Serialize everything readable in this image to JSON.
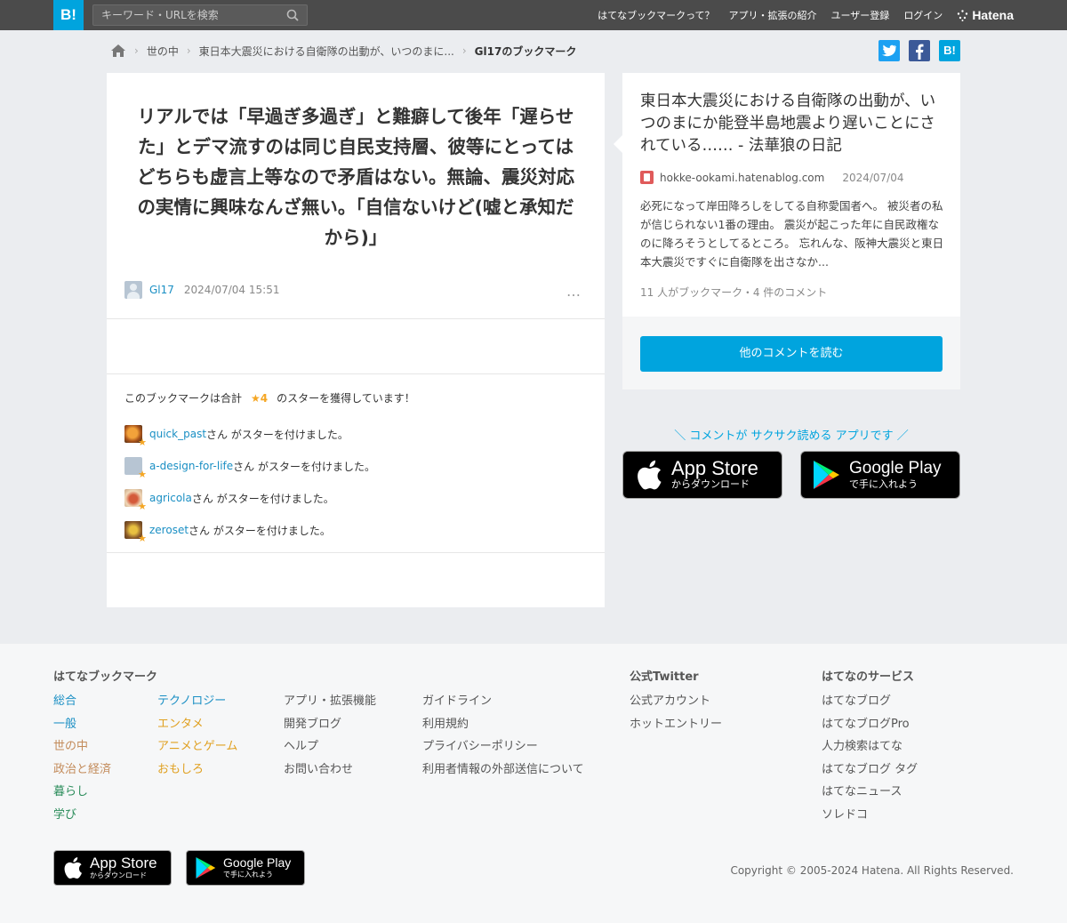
{
  "header": {
    "logo": "B!",
    "search_placeholder": "キーワード・URLを検索",
    "nav": [
      "はてなブックマークって？",
      "アプリ・拡張の紹介",
      "ユーザー登録",
      "ログイン"
    ],
    "brand": "Hatena"
  },
  "breadcrumb": {
    "items": [
      "世の中",
      "東日本大震災における自衛隊の出動が、いつのまに...",
      "Gl17のブックマーク"
    ]
  },
  "share": {
    "hatena": "B!"
  },
  "bookmark": {
    "comment": "リアルでは「早過ぎ多過ぎ」と難癖して後年「遅らせた」とデマ流すのは同じ自民支持層、彼等にとってはどちらも虚言上等なので矛盾はない。無論、震災対応の実情に興味なんざ無い。「自信ないけど(嘘と承知だから)」",
    "user": "Gl17",
    "date": "2024/07/04 15:51",
    "menu": "…"
  },
  "stars": {
    "title_pre": "このブックマークは合計",
    "count": "★4",
    "title_post": "のスターを獲得しています！",
    "suffix": "さん がスターを付けました。",
    "users": [
      "quick_past",
      "a-design-for-life",
      "agricola",
      "zeroset"
    ]
  },
  "entry": {
    "title": "東日本大震災における自衛隊の出動が、いつのまにか能登半島地震より遅いことにされている…… - 法華狼の日記",
    "domain": "hokke-ookami.hatenablog.com",
    "date": "2024/07/04",
    "description": "必死になって岸田降ろしをしてる自称愛国者へ。 被災者の私が信じられない1番の理由。 震災が起こった年に自民政権なのに降ろそうとしてるところ。 忘れんな、阪神大震災と東日本大震災ですぐに自衛隊を出さなか...",
    "stats": "11 人がブックマーク・4 件のコメント",
    "more_button": "他のコメントを読む"
  },
  "app_promo": {
    "note": "＼ コメントが サクサク読める アプリです ／",
    "appstore_big": "App Store",
    "appstore_small": "からダウンロード",
    "googleplay_big": "Google Play",
    "googleplay_small": "で手に入れよう"
  },
  "footer": {
    "bookmark_heading": "はてなブックマーク",
    "categories_col1": [
      "総合",
      "一般",
      "世の中",
      "政治と経済",
      "暮らし",
      "学び"
    ],
    "categories_col2": [
      "テクノロジー",
      "エンタメ",
      "アニメとゲーム",
      "おもしろ"
    ],
    "links_col3": [
      "アプリ・拡張機能",
      "開発ブログ",
      "ヘルプ",
      "お問い合わせ"
    ],
    "links_col4": [
      "ガイドライン",
      "利用規約",
      "プライバシーポリシー",
      "利用者情報の外部送信について"
    ],
    "twitter_heading": "公式Twitter",
    "twitter_links": [
      "公式アカウント",
      "ホットエントリー"
    ],
    "services_heading": "はてなのサービス",
    "services_links": [
      "はてなブログ",
      "はてなブログPro",
      "人力検索はてな",
      "はてなブログ タグ",
      "はてなニュース",
      "ソレドコ"
    ],
    "copyright": "Copyright © 2005-2024 Hatena. All Rights Reserved."
  },
  "colors": {
    "brand_blue": "#00a4de",
    "link_blue": "#1a8fc4",
    "star_orange": "#f5a623",
    "cat_col1": [
      "#1a8fc4",
      "#1a8fc4",
      "#c38b5a",
      "#c38b5a",
      "#2a8c5a",
      "#2a8c5a"
    ],
    "cat_col2": [
      "#1a8fc4",
      "#e0a020",
      "#e0a020",
      "#e0a020"
    ]
  }
}
